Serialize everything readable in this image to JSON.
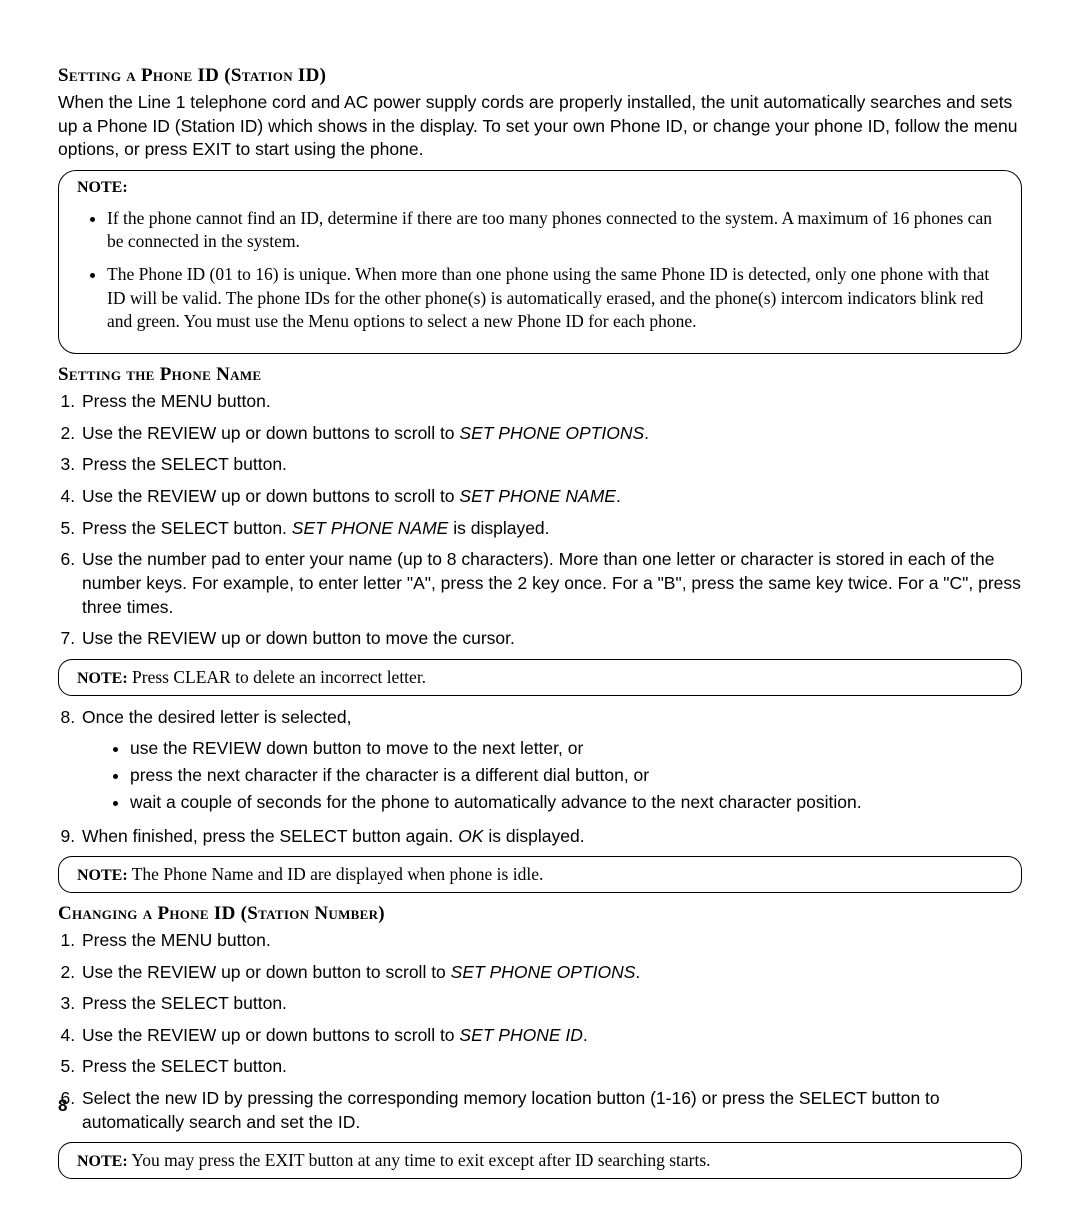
{
  "section1": {
    "heading": "Setting a Phone ID (Station ID)",
    "paragraph": "When the Line 1 telephone cord and AC power supply cords are properly installed, the unit automatically searches and sets up a Phone ID (Station ID) which shows in the display. To set your own Phone ID, or change your phone ID, follow the menu options, or press EXIT to start using the phone."
  },
  "noteBox1": {
    "label": "NOTE:",
    "bullets": [
      "If the phone cannot find an ID, determine if there are too many phones connected to the system. A maximum  of 16 phones can be connected in the system.",
      "The Phone ID (01 to 16) is unique. When more than one phone using the same Phone ID  is  detected, only one phone with that  ID will be  valid. The phone IDs for the other phone(s) is automatically erased, and the phone(s) intercom indicators blink red and green. You must use the Menu options to select a new Phone ID for each phone."
    ]
  },
  "section2": {
    "heading": "Setting the Phone Name",
    "steps_a": [
      "Press the MENU button.",
      {
        "pre": "Use the REVIEW up or down buttons to scroll to ",
        "em": "SET PHONE OPTIONS",
        "post": "."
      },
      "Press the SELECT button.",
      {
        "pre": "Use the REVIEW up or down buttons to scroll  to ",
        "em": "SET PHONE NAME",
        "post": "."
      },
      {
        "pre": "Press the SELECT button. ",
        "em": "SET PHONE NAME",
        "post": "  is displayed."
      },
      "Use the number pad to enter your name (up to 8 characters). More than one letter or character is stored in each of the number keys. For example, to enter letter \"A\", press the 2 key once. For a \"B\", press the same key twice. For a \"C\", press three times.",
      "Use the REVIEW up or down button to move  the cursor."
    ],
    "innerNote1": {
      "label": "NOTE:",
      "text": "  Press CLEAR to delete an incorrect letter."
    },
    "step8_lead": "Once the desired letter is selected,",
    "step8_bullets": [
      "use the REVIEW down button to move to the next letter, or",
      "press the next character if the character is a different dial button, or",
      "wait a couple of seconds for the phone to automatically advance to the next character position."
    ],
    "step9": {
      "pre": "When finished, press the SELECT button again. ",
      "em": "OK",
      "post": " is displayed."
    },
    "innerNote2": {
      "label": "NOTE:",
      "text": "  The Phone Name and ID are displayed when phone is idle."
    }
  },
  "section3": {
    "heading": "Changing a Phone ID (Station Number)",
    "steps": [
      "Press the MENU button.",
      {
        "pre": "Use the REVIEW up or  down button to scroll  to ",
        "em": "SET PHONE OPTIONS",
        "post": "."
      },
      "Press the SELECT button.",
      {
        "pre": "Use the REVIEW up or down buttons to scroll  to ",
        "em": "SET PHONE ID",
        "post": "."
      },
      "Press the SELECT button.",
      "Select  the new ID by pressing the corresponding memory location button (1-16) or press the SELECT button to automatically search and set the ID."
    ],
    "innerNote": {
      "label": "NOTE:",
      "text": "  You may press the EXIT button at any time to exit except after ID searching starts."
    }
  },
  "pageNumber": "8"
}
